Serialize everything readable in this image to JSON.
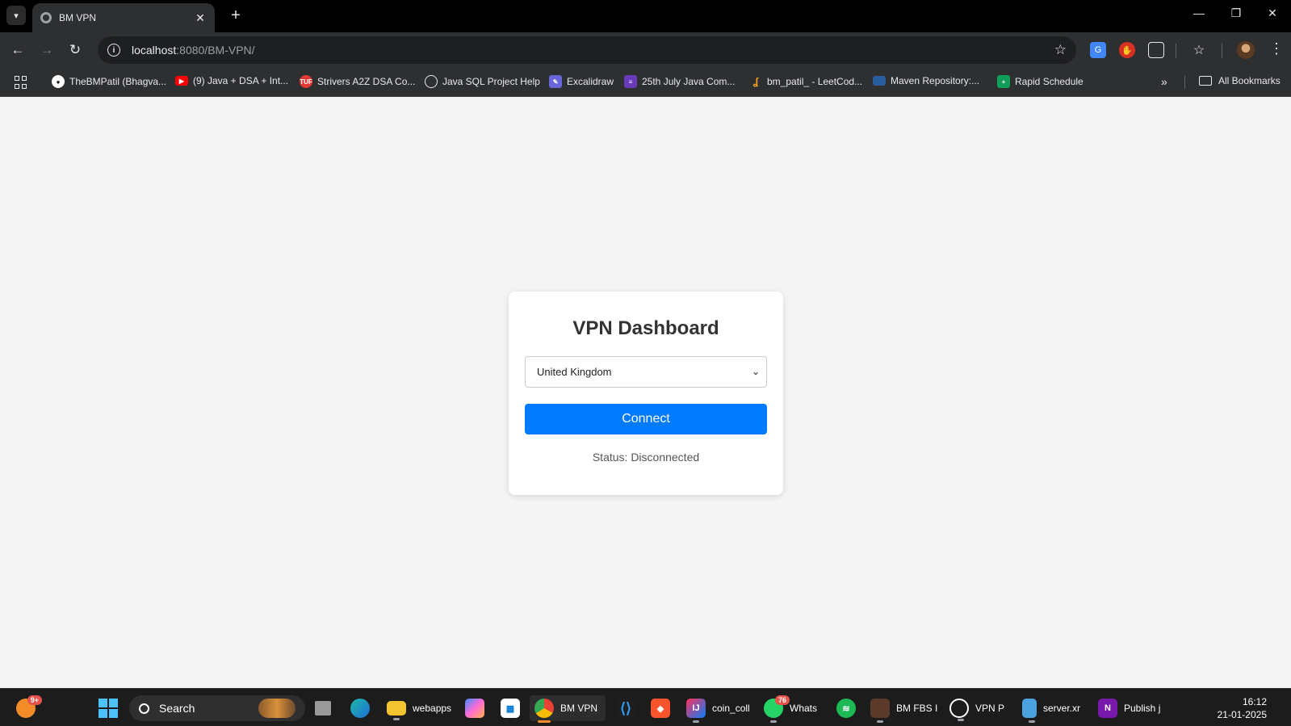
{
  "browser": {
    "tab_title": "BM VPN",
    "new_tab_symbol": "+",
    "url_host": "localhost",
    "url_path": ":8080/BM-VPN/",
    "bookmarks": [
      {
        "label": "TheBMPatil (Bhagva...",
        "icon": "github-icon",
        "color": "#ffffff"
      },
      {
        "label": "(9) Java + DSA + Int...",
        "icon": "youtube-icon",
        "color": "#ff0000"
      },
      {
        "label": "Strivers A2Z DSA Co...",
        "icon": "tuf-icon",
        "color": "#e53935"
      },
      {
        "label": "Java SQL Project Help",
        "icon": "openai-icon",
        "color": "#ffffff"
      },
      {
        "label": "Excalidraw",
        "icon": "excalidraw-icon",
        "color": "#6965db"
      },
      {
        "label": "25th July Java Com...",
        "icon": "form-icon",
        "color": "#673ab7"
      },
      {
        "label": "bm_patil_ - LeetCod...",
        "icon": "leetcode-icon",
        "color": "#ffa116"
      },
      {
        "label": "Maven Repository:...",
        "icon": "maven-icon",
        "color": "#2a5d9f"
      },
      {
        "label": "Rapid Schedule",
        "icon": "sheets-icon",
        "color": "#0f9d58"
      }
    ],
    "all_bookmarks": "All Bookmarks"
  },
  "page": {
    "title": "VPN Dashboard",
    "country_selected": "United Kingdom",
    "connect_label": "Connect",
    "status_text": "Status: Disconnected",
    "accent_color": "#007bff"
  },
  "taskbar": {
    "notification_badge": "9+",
    "search_label": "Search",
    "apps": [
      {
        "label": "webapps",
        "icon": "folder-icon"
      },
      {
        "label": "BM VPN",
        "icon": "chrome-icon"
      },
      {
        "label": "coin_coll",
        "icon": "intellij-icon"
      },
      {
        "label": "Whats",
        "icon": "whatsapp-icon",
        "badge": "76"
      },
      {
        "label": "BM FBS I",
        "icon": "game-icon"
      },
      {
        "label": "VPN P",
        "icon": "chatgpt-icon"
      },
      {
        "label": "server.xr",
        "icon": "notepad-icon"
      },
      {
        "label": "Publish j",
        "icon": "onenote-icon"
      }
    ],
    "time": "16:12",
    "date": "21-01-2025"
  }
}
